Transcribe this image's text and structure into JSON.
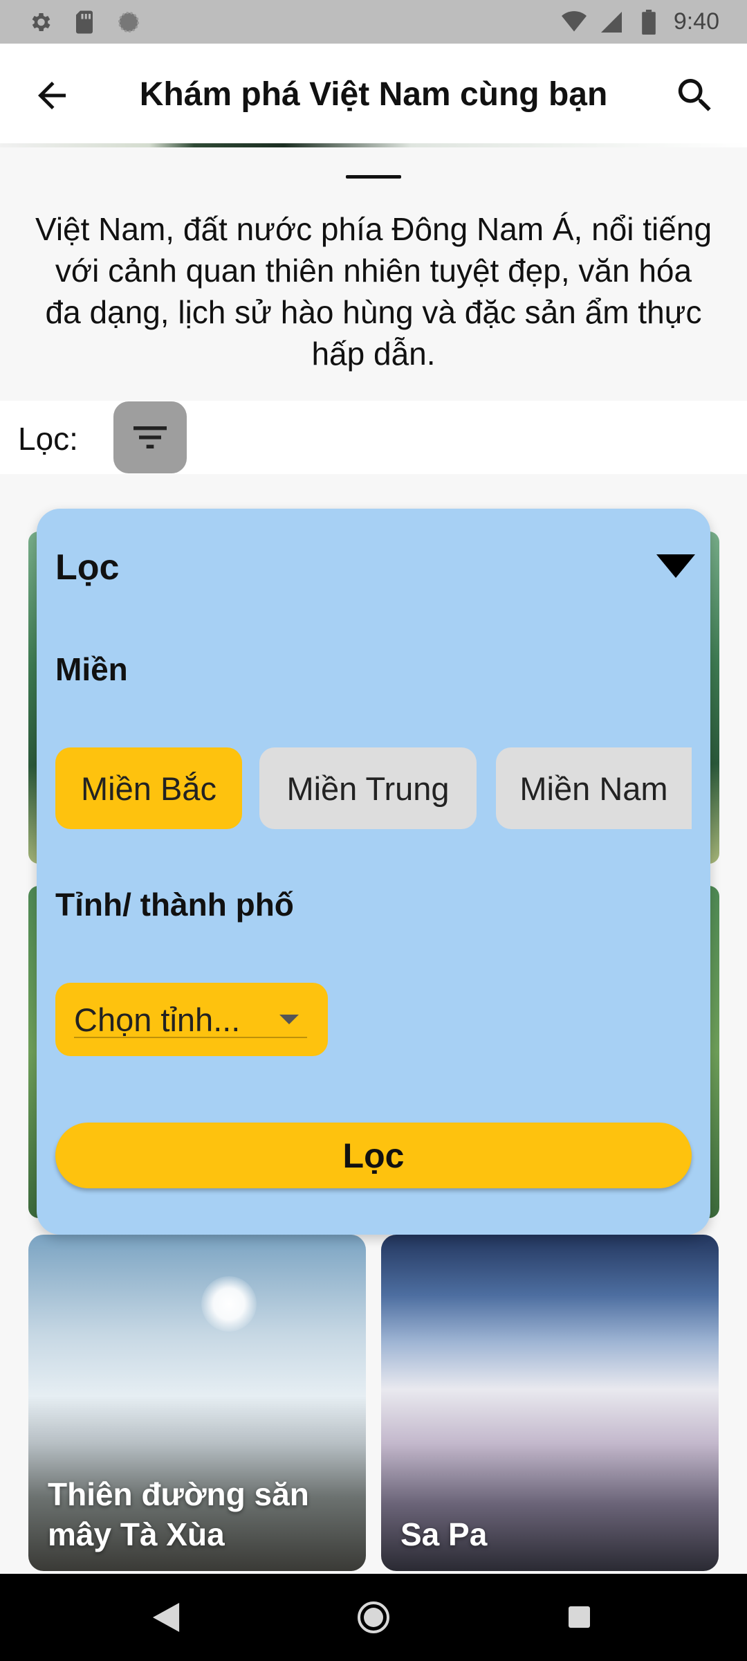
{
  "status_bar": {
    "time": "9:40",
    "icons": [
      "settings-icon",
      "sd-card-icon",
      "circle-status-icon",
      "wifi-icon",
      "signal-icon",
      "battery-icon"
    ]
  },
  "app_bar": {
    "title": "Khám phá Việt Nam cùng bạn",
    "back_icon": "arrow-left-icon",
    "search_icon": "search-icon"
  },
  "intro": {
    "text": "Việt Nam, đất nước phía Đông Nam Á, nổi tiếng với cảnh quan thiên nhiên tuyệt đẹp, văn hóa đa dạng, lịch sử hào hùng và đặc sản ẩm thực hấp dẫn."
  },
  "filter_row": {
    "label": "Lọc:",
    "icon": "filter-icon"
  },
  "filter_panel": {
    "title": "Lọc",
    "region_label": "Miền",
    "regions": [
      {
        "label": "Miền Bắc",
        "selected": true
      },
      {
        "label": "Miền Trung",
        "selected": false
      },
      {
        "label": "Miền Nam",
        "selected": false
      }
    ],
    "province_label": "Tỉnh/ thành phố",
    "province_select": {
      "value": "Chọn tỉnh..."
    },
    "apply_label": "Lọc"
  },
  "cards": [
    {
      "caption": "Thiên đường săn mây Tà Xùa"
    },
    {
      "caption": "Sa Pa"
    }
  ],
  "colors": {
    "accent": "#fec20e",
    "panel_bg": "#a7d0f4",
    "chip_inactive": "#dddddd",
    "filter_button_bg": "#9e9e9e"
  }
}
